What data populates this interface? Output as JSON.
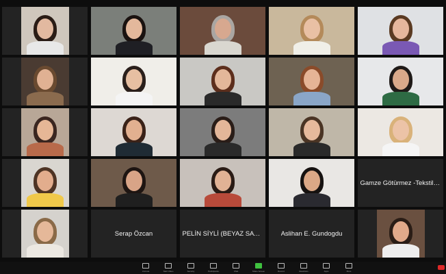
{
  "participants": [
    {
      "type": "video",
      "name": "",
      "bg": "#cfc7bd",
      "skin": "#e2b9a0",
      "hair": "#2a1c16",
      "shirt": "#e8e8e8"
    },
    {
      "type": "video",
      "name": "",
      "bg": "#7b7f7a",
      "skin": "#e3b89c",
      "hair": "#1a1210",
      "shirt": "#1f1f24"
    },
    {
      "type": "video",
      "name": "",
      "bg": "#6b4b3c",
      "skin": "#d7a88f",
      "hair": "#aaa6a2",
      "shirt": "#d9d7d0",
      "active": true
    },
    {
      "type": "video",
      "name": "",
      "bg": "#c9b89c",
      "skin": "#e9c0a4",
      "hair": "#b48a5a",
      "shirt": "#f0efe8"
    },
    {
      "type": "video",
      "name": "",
      "bg": "#dfe1e4",
      "skin": "#e6b79d",
      "hair": "#5a3a22",
      "shirt": "#7a59b4"
    },
    {
      "type": "video",
      "name": "",
      "bg": "#4a3b32",
      "skin": "#e0b193",
      "hair": "#6a4a30",
      "shirt": "#8b6b4e"
    },
    {
      "type": "video",
      "name": "",
      "bg": "#f0eee9",
      "skin": "#e7bfa2",
      "hair": "#2a1f1b",
      "shirt": "#f4f4f4"
    },
    {
      "type": "video",
      "name": "",
      "bg": "#c9c8c4",
      "skin": "#e3b79a",
      "hair": "#5c2e1c",
      "shirt": "#2a2a2a"
    },
    {
      "type": "video",
      "name": "",
      "bg": "#6e6252",
      "skin": "#e5b496",
      "hair": "#8a4b2a",
      "shirt": "#8aa6c8"
    },
    {
      "type": "video",
      "name": "",
      "bg": "#e7e8ea",
      "skin": "#d9a98a",
      "hair": "#1f1a18",
      "shirt": "#2e6b44"
    },
    {
      "type": "video",
      "name": "",
      "bg": "#b8a797",
      "skin": "#e6b796",
      "hair": "#3a2620",
      "shirt": "#b86a4a"
    },
    {
      "type": "video",
      "name": "",
      "bg": "#ddd8d3",
      "skin": "#e2b090",
      "hair": "#3a2218",
      "shirt": "#1f2b34"
    },
    {
      "type": "video",
      "name": "",
      "bg": "#7c7c7c",
      "skin": "#e3b699",
      "hair": "#2a1d18",
      "shirt": "#2a2a2a"
    },
    {
      "type": "video",
      "name": "",
      "bg": "#bfb7a8",
      "skin": "#e6b99c",
      "hair": "#4a3424",
      "shirt": "#2a2a2a"
    },
    {
      "type": "video",
      "name": "",
      "bg": "#ece8e3",
      "skin": "#ecc3a7",
      "hair": "#d9b27a",
      "shirt": "#f5f5f5"
    },
    {
      "type": "video",
      "name": "",
      "bg": "#d9d6d0",
      "skin": "#e2ad8d",
      "hair": "#4e3424",
      "shirt": "#f0c94a"
    },
    {
      "type": "video",
      "name": "",
      "bg": "#6e5a4a",
      "skin": "#d8a487",
      "hair": "#1e1512",
      "shirt": "#1f1f1f"
    },
    {
      "type": "video",
      "name": "",
      "bg": "#c8c1bb",
      "skin": "#e1b295",
      "hair": "#2a1b15",
      "shirt": "#b84a3a"
    },
    {
      "type": "video",
      "name": "",
      "bg": "#e9e7e4",
      "skin": "#dba886",
      "hair": "#161210",
      "shirt": "#2a2a30"
    },
    {
      "type": "name",
      "name": "Gamze Götürmez -Tekstil v..."
    },
    {
      "type": "video",
      "name": "",
      "bg": "#d5d2cd",
      "skin": "#e5b899",
      "hair": "#8a6a48",
      "shirt": "#ece8e2"
    },
    {
      "type": "name",
      "name": "Serap Özcan"
    },
    {
      "type": "name",
      "name": "PELİN SİYLİ (BEYAZ SAYF..."
    },
    {
      "type": "name",
      "name": "Aslihan E. Gundogdu"
    },
    {
      "type": "video",
      "name": "",
      "bg": "#6a5040",
      "skin": "#e0a98a",
      "hair": "#2a1d16",
      "shirt": "#eeeeee"
    }
  ],
  "toolbar": {
    "items": [
      {
        "label": "Unmute",
        "icon": "microphone-icon"
      },
      {
        "label": "Start Video",
        "icon": "video-camera-icon"
      },
      {
        "label": "Security",
        "icon": "shield-icon"
      },
      {
        "label": "Participants",
        "icon": "participants-icon"
      },
      {
        "label": "Chat",
        "icon": "chat-icon"
      },
      {
        "label": "Share Screen",
        "icon": "share-screen-icon"
      },
      {
        "label": "Record",
        "icon": "record-icon"
      },
      {
        "label": "Reactions",
        "icon": "reactions-icon"
      },
      {
        "label": "Apps",
        "icon": "apps-icon"
      },
      {
        "label": "More",
        "icon": "more-icon"
      }
    ],
    "end_label": "End",
    "accent": "#3fc13f",
    "end_color": "#e02828"
  }
}
